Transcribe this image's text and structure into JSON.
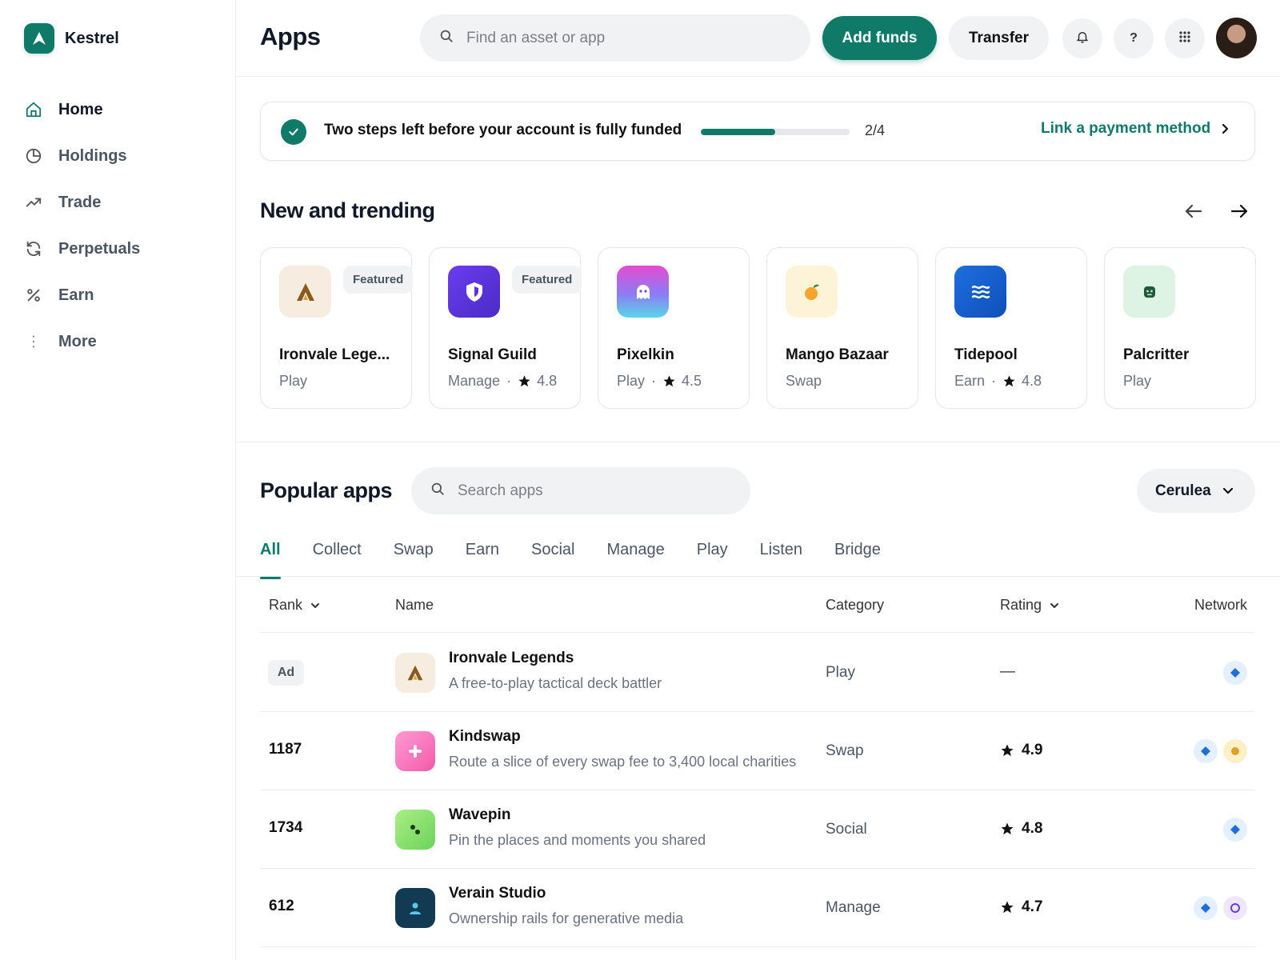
{
  "brand": {
    "name": "Kestrel",
    "accent": "#0f7a68"
  },
  "sidebar": {
    "items": [
      {
        "label": "Home",
        "icon": "home-icon",
        "active": true
      },
      {
        "label": "Holdings",
        "icon": "pie-chart-icon"
      },
      {
        "label": "Trade",
        "icon": "trend-up-icon"
      },
      {
        "label": "Perpetuals",
        "icon": "refresh-icon"
      },
      {
        "label": "Earn",
        "icon": "percent-icon"
      },
      {
        "label": "More",
        "icon": "more-vertical-icon"
      }
    ]
  },
  "header": {
    "title": "Apps",
    "search_placeholder": "Find an asset or app",
    "add_funds": "Add funds",
    "transfer": "Transfer",
    "help": "?"
  },
  "banner": {
    "text": "Two steps left before your account is fully funded",
    "progress": 0.5,
    "count": "2/4",
    "link": "Link a payment method"
  },
  "trending": {
    "title": "New and trending",
    "cards": [
      {
        "name": "Ironvale Lege...",
        "category": "Play",
        "badge": "Featured",
        "rating": "",
        "icon": "ironvale-logo-icon"
      },
      {
        "name": "Signal Guild",
        "category": "Manage",
        "badge": "Featured",
        "rating": "4.8",
        "icon": "shield-icon"
      },
      {
        "name": "Pixelkin",
        "category": "Play",
        "badge": "",
        "rating": "4.5",
        "icon": "ghost-icon"
      },
      {
        "name": "Mango Bazaar",
        "category": "Swap",
        "badge": "",
        "rating": "",
        "icon": "mango-icon"
      },
      {
        "name": "Tidepool",
        "category": "Earn",
        "badge": "",
        "rating": "4.8",
        "icon": "waves-icon"
      },
      {
        "name": "Palcritter",
        "category": "Play",
        "badge": "",
        "rating": "",
        "icon": "critter-face-icon"
      }
    ]
  },
  "popular": {
    "title": "Popular apps",
    "search_placeholder": "Search apps",
    "network": "Cerulea",
    "tabs": [
      "All",
      "Collect",
      "Swap",
      "Earn",
      "Social",
      "Manage",
      "Play",
      "Listen",
      "Bridge"
    ],
    "columns": {
      "rank": "Rank",
      "name": "Name",
      "category": "Category",
      "rating": "Rating",
      "network": "Network"
    },
    "rows": [
      {
        "rank": "",
        "ad": "Ad",
        "name": "Ironvale Legends",
        "desc": "A free-to-play tactical deck battler",
        "category": "Play",
        "rating": "—",
        "icon": "ironvale-logo-icon",
        "networks": [
          "cerulea"
        ]
      },
      {
        "rank": "1187",
        "ad": "",
        "name": "Kindswap",
        "desc": "Route a slice of every swap fee to 3,400 local charities",
        "category": "Swap",
        "rating": "4.9",
        "icon": "sparkle-cross-icon",
        "networks": [
          "cerulea",
          "amber"
        ]
      },
      {
        "rank": "1734",
        "ad": "",
        "name": "Wavepin",
        "desc": "Pin the places and moments you shared",
        "category": "Social",
        "rating": "4.8",
        "icon": "pins-icon",
        "networks": [
          "cerulea"
        ]
      },
      {
        "rank": "612",
        "ad": "",
        "name": "Verain Studio",
        "desc": "Ownership rails for generative media",
        "category": "Manage",
        "rating": "4.7",
        "icon": "user-icon",
        "networks": [
          "cerulea",
          "violet"
        ]
      }
    ]
  }
}
